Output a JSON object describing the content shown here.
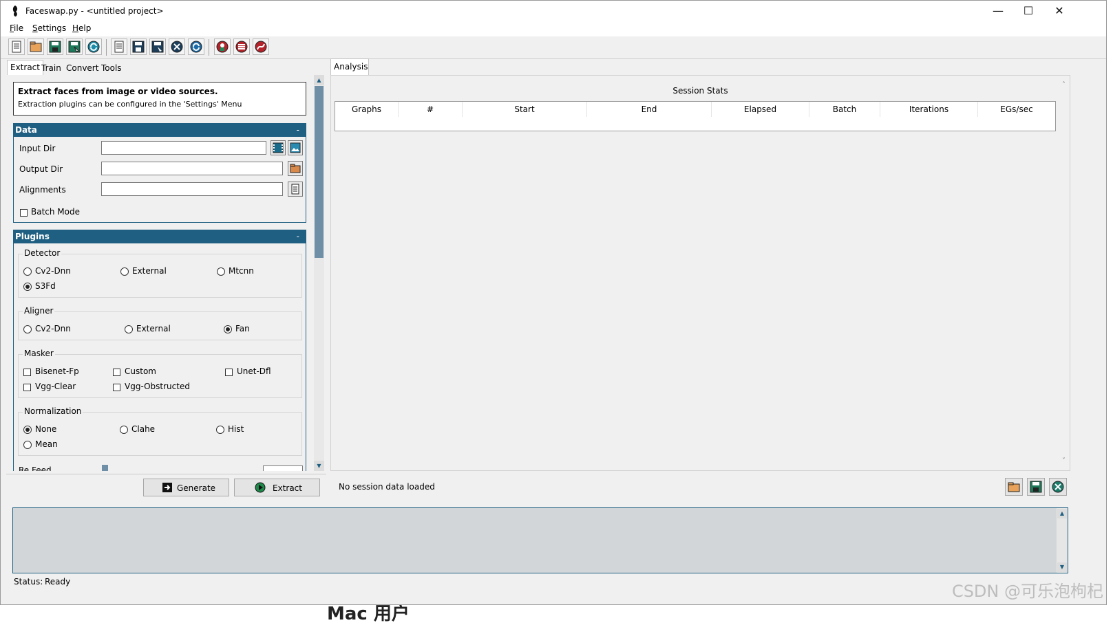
{
  "window": {
    "title": "Faceswap.py - <untitled project>",
    "controls": {
      "minimize": "—",
      "maximize": "☐",
      "close": "✕"
    }
  },
  "menu": [
    {
      "key": "F",
      "rest": "ile"
    },
    {
      "key": "S",
      "rest": "ettings"
    },
    {
      "key": "H",
      "rest": "elp"
    }
  ],
  "toolbar_icons": [
    "new-project-icon",
    "open-project-icon",
    "save-project-icon",
    "save-as-project-icon",
    "reload-project-icon",
    "new-task-icon",
    "save-task-icon",
    "save-as-task-icon",
    "clear-task-icon",
    "reload-task-icon",
    "extract-settings-icon",
    "train-settings-icon",
    "convert-settings-icon"
  ],
  "left_tabs": [
    "Extract",
    "Train",
    "Convert",
    "Tools"
  ],
  "info": {
    "heading": "Extract faces from image or video sources.",
    "subtext": "Extraction plugins can be configured in the 'Settings' Menu"
  },
  "data_section": {
    "title": "Data",
    "collapse": "-",
    "fields": {
      "input_dir": {
        "label": "Input Dir",
        "value": ""
      },
      "output_dir": {
        "label": "Output Dir",
        "value": ""
      },
      "alignments": {
        "label": "Alignments",
        "value": ""
      }
    },
    "batch_mode": {
      "label": "Batch Mode",
      "checked": false
    }
  },
  "plugins_section": {
    "title": "Plugins",
    "collapse": "-",
    "detector": {
      "title": "Detector",
      "options": [
        "Cv2-Dnn",
        "External",
        "Mtcnn",
        "S3Fd"
      ],
      "selected": "S3Fd"
    },
    "aligner": {
      "title": "Aligner",
      "options": [
        "Cv2-Dnn",
        "External",
        "Fan"
      ],
      "selected": "Fan"
    },
    "masker": {
      "title": "Masker",
      "options": [
        "Bisenet-Fp",
        "Custom",
        "Unet-Dfl",
        "Vgg-Clear",
        "Vgg-Obstructed"
      ]
    },
    "normalization": {
      "title": "Normalization",
      "options": [
        "None",
        "Clahe",
        "Hist",
        "Mean"
      ],
      "selected": "None"
    },
    "partial_label": "Re Feed"
  },
  "actions": {
    "generate": "Generate",
    "extract": "Extract"
  },
  "analysis": {
    "tab": "Analysis",
    "heading": "Session Stats",
    "columns": [
      "Graphs",
      "#",
      "Start",
      "End",
      "Elapsed",
      "Batch",
      "Iterations",
      "EGs/sec"
    ],
    "status": "No session data loaded"
  },
  "status_bar": {
    "label": "Status:",
    "value": "Ready"
  },
  "background_text": "Mac 用户",
  "watermark": "CSDN @可乐泡枸杞",
  "colors": {
    "section_header": "#1f5f82",
    "console_bg": "#d3d6d9"
  }
}
